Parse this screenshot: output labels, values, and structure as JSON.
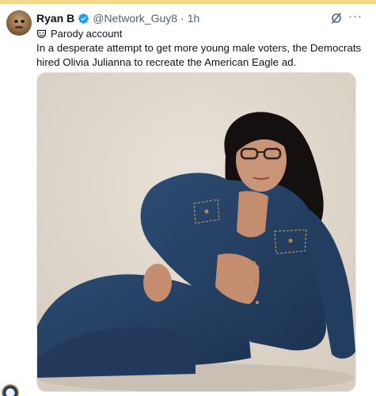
{
  "tweet": {
    "author_name": "Ryan B",
    "handle": "@Network_Guy8",
    "separator": "·",
    "time": "1h",
    "parody_label": "Parody account",
    "text": "In a desperate attempt to get more young male voters, the Democrats hired Olivia Julianna to recreate the American Eagle ad.",
    "more_glyph": "···",
    "colors": {
      "verified": "#1d9bf0",
      "secondary_text": "#536471",
      "top_accent": "#f4d98a"
    },
    "icons": [
      "verified-badge-icon",
      "grok-icon",
      "more-options-icon",
      "parody-mask-icon"
    ]
  }
}
